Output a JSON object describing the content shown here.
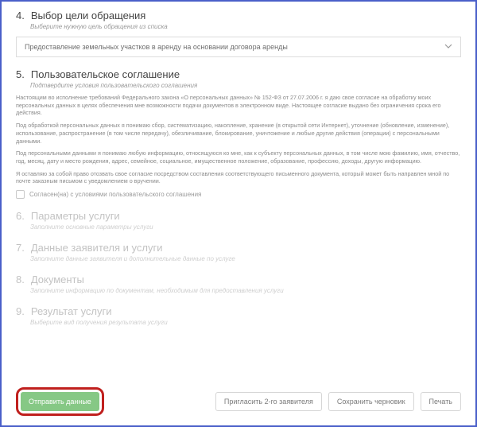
{
  "step4": {
    "num": "4.",
    "title": "Выбор цели обращения",
    "sub": "Выберите нужную цель обращения из списка",
    "selected": "Предоставление земельных участков в аренду на основании договора аренды"
  },
  "step5": {
    "num": "5.",
    "title": "Пользовательское соглашение",
    "sub": "Подтвердите условия пользовательского соглашения",
    "p1": "Настоящим во исполнение требований Федерального закона «О персональных данных» № 152-ФЗ от 27.07.2006 г. я даю свое согласие на обработку моих персональных данных в целях обеспечения мне возможности подачи документов в электронном виде. Настоящее согласие выдано без ограничения срока его действия.",
    "p2": "Под обработкой персональных данных я понимаю сбор, систематизацию, накопление, хранение (в открытой сети Интернет), уточнение (обновление, изменение), использование, распространение (в том числе передачу), обезличивание, блокирование, уничтожение и любые другие действия (операции) с персональными данными.",
    "p3": "Под персональными данными я понимаю любую информацию, относящуюся ко мне, как к субъекту персональных данных, в том числе мою фамилию, имя, отчество, год, месяц, дату и место рождения, адрес, семейное, социальное, имущественное положение, образование, профессию, доходы, другую информацию.",
    "p4": "Я оставляю за собой право отозвать свое согласие посредством составления соответствующего письменного документа, который может быть направлен мной по почте заказным письмом с уведомлением о вручении.",
    "chk": "Согласен(на) с условиями пользовательского соглашения"
  },
  "step6": {
    "num": "6.",
    "title": "Параметры услуги",
    "sub": "Заполните основные параметры услуги"
  },
  "step7": {
    "num": "7.",
    "title": "Данные заявителя и услуги",
    "sub": "Заполните данные заявителя и дополнительные данные по услуге"
  },
  "step8": {
    "num": "8.",
    "title": "Документы",
    "sub": "Заполните информацию по документам, необходимым для предоставления услуги"
  },
  "step9": {
    "num": "9.",
    "title": "Результат услуги",
    "sub": "Выберите вид получения результата услуги"
  },
  "footer": {
    "submit": "Отправить данные",
    "invite": "Пригласить 2-го заявителя",
    "draft": "Сохранить черновик",
    "print": "Печать"
  }
}
